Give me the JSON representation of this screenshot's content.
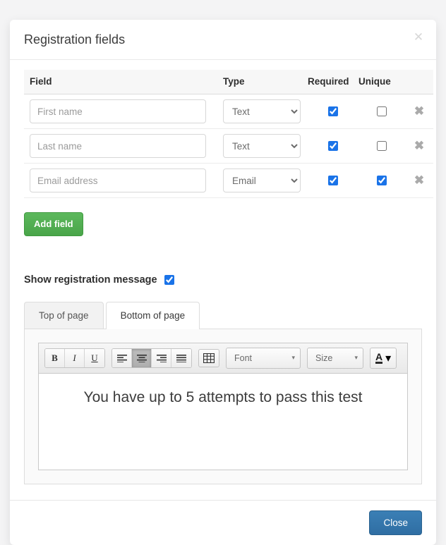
{
  "modal": {
    "title": "Registration fields",
    "dismiss_icon": "close-icon",
    "dismiss_glyph": "✕"
  },
  "table": {
    "headers": {
      "field": "Field",
      "type": "Type",
      "required": "Required",
      "unique": "Unique"
    },
    "rows": [
      {
        "field_placeholder": "First name",
        "field_value": "",
        "type": "Text",
        "required": true,
        "unique": false,
        "delete_glyph": "✖"
      },
      {
        "field_placeholder": "Last name",
        "field_value": "",
        "type": "Text",
        "required": true,
        "unique": false,
        "delete_glyph": "✖"
      },
      {
        "field_placeholder": "Email address",
        "field_value": "",
        "type": "Email",
        "required": true,
        "unique": true,
        "delete_glyph": "✖"
      }
    ],
    "type_options": [
      "Text",
      "Email"
    ]
  },
  "add_field": {
    "label": "Add field",
    "color": "#4aa54a"
  },
  "registration_message": {
    "label": "Show registration message",
    "checked": true
  },
  "tabs": [
    {
      "label": "Top of page",
      "active": false
    },
    {
      "label": "Bottom of page",
      "active": true
    }
  ],
  "editor": {
    "toolbar": {
      "bold": "B",
      "italic": "I",
      "underline": "U",
      "align_left": "align-left-icon",
      "align_center": "align-center-icon",
      "align_right": "align-right-icon",
      "align_justify": "align-justify-icon",
      "table": "table-icon",
      "font_label": "Font",
      "size_label": "Size",
      "color_letter": "A",
      "caret_glyph": "▾",
      "active_alignment": "align-center"
    },
    "content": "You have up to 5 attempts to pass this test"
  },
  "footer": {
    "close_label": "Close",
    "close_color": "#2f6ea3"
  }
}
